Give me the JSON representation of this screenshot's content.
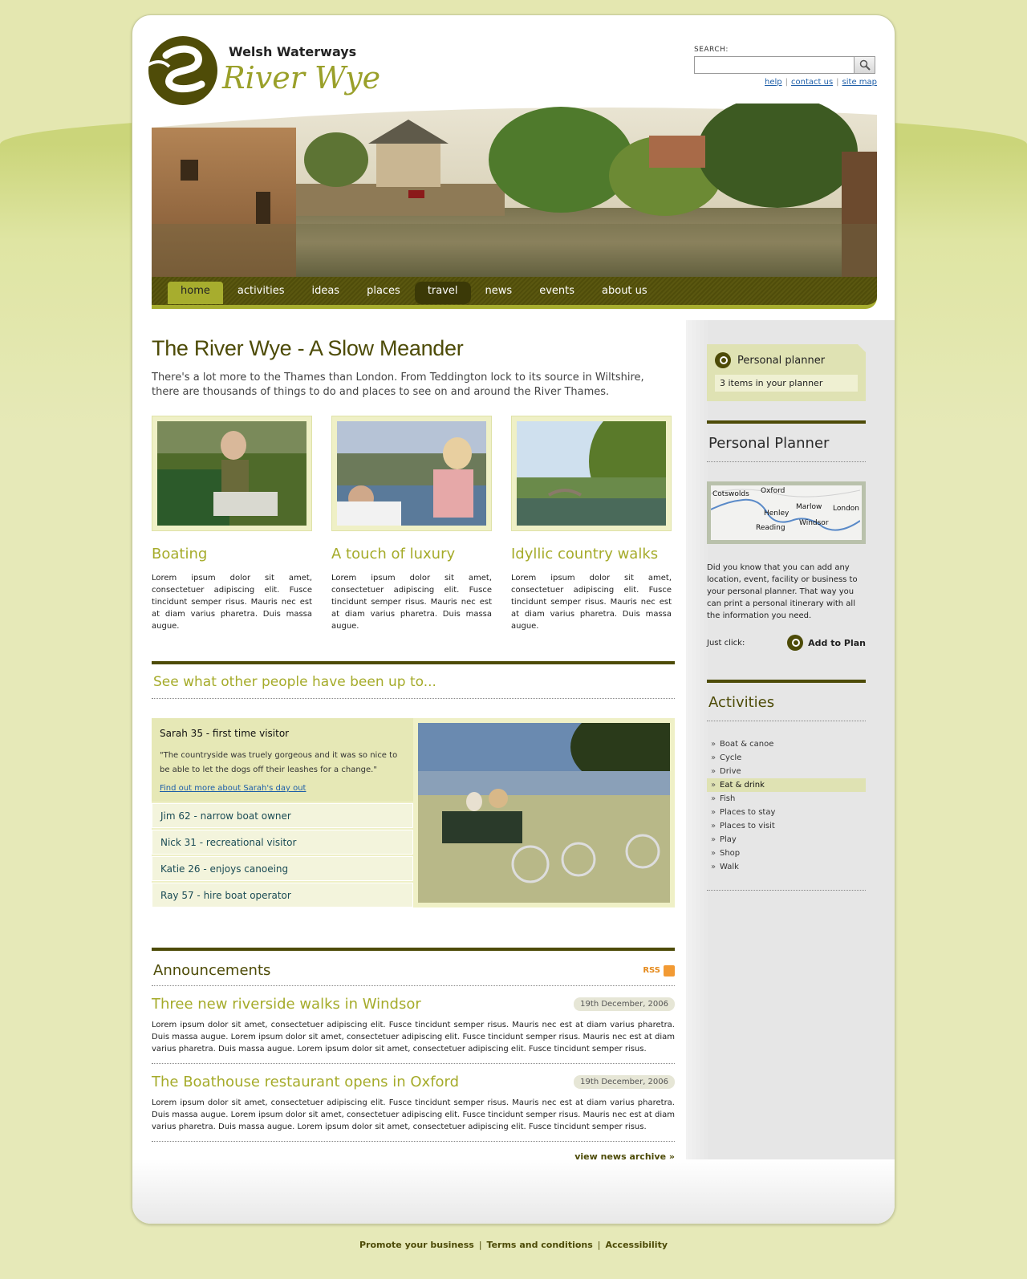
{
  "logo": {
    "top": "Welsh Waterways",
    "bottom": "River Wye"
  },
  "search": {
    "label": "SEARCH:",
    "placeholder": ""
  },
  "top_links": [
    "help",
    "contact us",
    "site map"
  ],
  "nav": [
    "home",
    "activities",
    "ideas",
    "places",
    "travel",
    "news",
    "events",
    "about us"
  ],
  "main": {
    "title": "The River Wye - A Slow Meander",
    "intro": "There's a lot more to the Thames than London.  From Teddington lock to its source in Wiltshire, there are thousands of things to do and places to see on and around the River Thames.",
    "features": [
      {
        "title": "Boating",
        "text": "Lorem ipsum dolor sit amet, consectetuer adipiscing elit. Fusce tincidunt semper risus. Mauris nec est at diam varius pharetra. Duis massa augue."
      },
      {
        "title": "A touch of luxury",
        "text": "Lorem ipsum dolor sit amet, consectetuer adipiscing elit. Fusce tincidunt semper risus. Mauris nec est at diam varius pharetra. Duis massa augue."
      },
      {
        "title": "Idyllic country walks",
        "text": "Lorem ipsum dolor sit amet, consectetuer adipiscing elit. Fusce tincidunt semper risus. Mauris nec est at diam varius pharetra. Duis massa augue."
      }
    ],
    "people_title": "See what other people have been up to...",
    "quote": {
      "name": "Sarah 35 - first time visitor",
      "text": "\"The countryside was truely gorgeous and it was so nice to be able to let the dogs off their leashes for a change.\"",
      "link": "Find out more about Sarah's day out"
    },
    "people": [
      "Jim 62 - narrow boat owner",
      "Nick 31 - recreational visitor",
      "Katie 26 - enjoys canoeing",
      "Ray 57 - hire boat operator"
    ],
    "announcements": {
      "title": "Announcements",
      "rss": "RSS",
      "items": [
        {
          "title": "Three new riverside walks in Windsor",
          "date": "19th December, 2006",
          "text": "Lorem ipsum dolor sit amet, consectetuer adipiscing elit. Fusce tincidunt semper risus. Mauris nec est at diam varius pharetra. Duis massa augue. Lorem ipsum dolor sit amet, consectetuer adipiscing elit. Fusce tincidunt semper risus. Mauris nec est at diam varius pharetra. Duis massa augue. Lorem ipsum dolor sit amet, consectetuer adipiscing elit. Fusce tincidunt semper risus."
        },
        {
          "title": "The Boathouse restaurant opens in Oxford",
          "date": "19th December, 2006",
          "text": "Lorem ipsum dolor sit amet, consectetuer adipiscing elit. Fusce tincidunt semper risus. Mauris nec est at diam varius pharetra. Duis massa augue. Lorem ipsum dolor sit amet, consectetuer adipiscing elit. Fusce tincidunt semper risus. Mauris nec est at diam varius pharetra. Duis massa augue. Lorem ipsum dolor sit amet, consectetuer adipiscing elit. Fusce tincidunt semper risus."
        }
      ],
      "archive": "view news archive »"
    }
  },
  "sidebar": {
    "planner_head": "Personal planner",
    "planner_count": "3 items in your planner",
    "planner_title": "Personal Planner",
    "map_labels": [
      "Cotswolds",
      "Oxford",
      "Marlow",
      "London",
      "Henley",
      "Windsor",
      "Reading"
    ],
    "text": "Did you know that you can add any location, event, facility or business to your personal planner. That way you can print a personal itinerary with all the information you need.",
    "just_click": "Just click:",
    "add_plan": "Add to Plan",
    "activities_title": "Activities",
    "activities": [
      "Boat & canoe",
      "Cycle",
      "Drive",
      "Eat & drink",
      "Fish",
      "Places to stay",
      "Places to visit",
      "Play",
      "Shop",
      "Walk"
    ]
  },
  "footer": [
    "Promote your business",
    "Terms and conditions",
    "Accessibility"
  ],
  "colors": {
    "olive": "#4d4b07",
    "lime": "#a5ab2a",
    "bg": "#e4e7b0"
  }
}
